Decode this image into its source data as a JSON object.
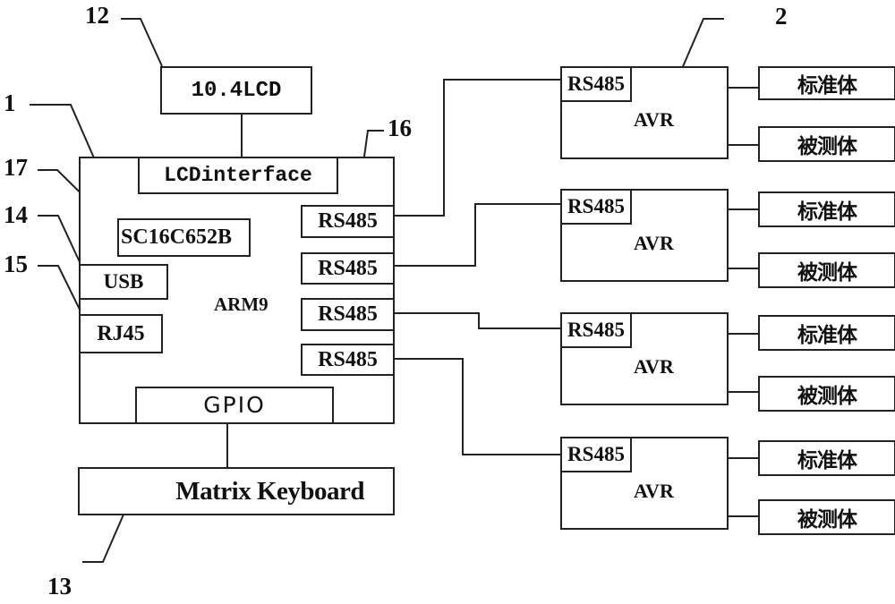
{
  "diagram": {
    "callouts": {
      "c1": "1",
      "c2": "2",
      "c12": "12",
      "c13": "13",
      "c14": "14",
      "c15": "15",
      "c16": "16",
      "c17": "17"
    },
    "lcd": "10.4LCD",
    "arm": {
      "label": "ARM9",
      "lcd_interface": "LCDinterface",
      "uart_chip": "SC16C652B",
      "usb": "USB",
      "rj45": "RJ45",
      "gpio": "GPIO",
      "rs485_ports": [
        "RS485",
        "RS485",
        "RS485",
        "RS485"
      ]
    },
    "keyboard": "Matrix Keyboard",
    "avr_nodes": [
      {
        "rs485": "RS485",
        "label": "AVR",
        "standard": "标准体",
        "tested": "被测体"
      },
      {
        "rs485": "RS485",
        "label": "AVR",
        "standard": "标准体",
        "tested": "被测体"
      },
      {
        "rs485": "RS485",
        "label": "AVR",
        "standard": "标准体",
        "tested": "被测体"
      },
      {
        "rs485": "RS485",
        "label": "AVR",
        "standard": "标准体",
        "tested": "被测体"
      }
    ]
  }
}
